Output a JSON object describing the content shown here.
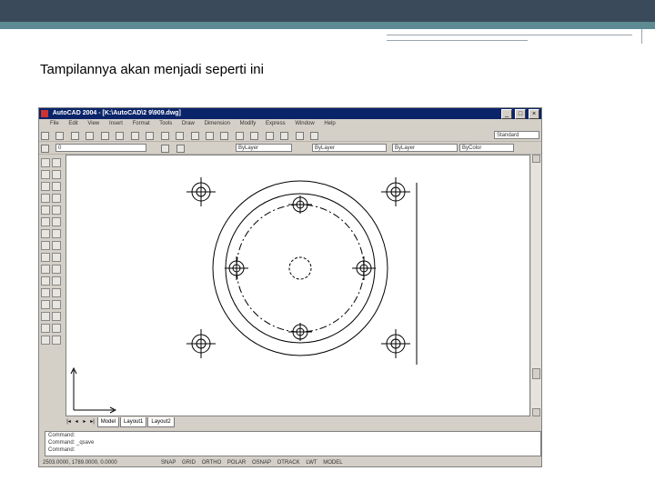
{
  "slide": {
    "caption": "Tampilannya akan menjadi seperti ini"
  },
  "app": {
    "title": "AutoCAD 2004 - [K:\\AutoCAD\\2 9\\909.dwg]",
    "window_buttons": [
      "_",
      "□",
      "×"
    ],
    "menus": [
      "File",
      "Edit",
      "View",
      "Insert",
      "Format",
      "Tools",
      "Draw",
      "Dimension",
      "Modify",
      "Express",
      "Window",
      "Help"
    ],
    "layer_combo": "0",
    "color_combo": "ByLayer",
    "linetype_combo": "ByLayer",
    "lineweight_combo": "ByLayer",
    "plotstyle_combo": "ByColor",
    "style_combo": "Standard",
    "tabs": [
      "Model",
      "Layout1",
      "Layout2"
    ],
    "command_lines": [
      "Command:",
      "Command: _qsave",
      "Command:"
    ],
    "coordinates": "2503.0000, 1789.0000, 0.0000",
    "status_modes": [
      "SNAP",
      "GRID",
      "ORTHO",
      "POLAR",
      "OSNAP",
      "OTRACK",
      "LWT",
      "MODEL"
    ]
  },
  "colors": {
    "title_bar": "#0a246a",
    "chrome": "#d4d0c8",
    "canvas": "#ffffff",
    "slide_header": "#3b4a5a",
    "slide_accent": "#5d8a93"
  }
}
